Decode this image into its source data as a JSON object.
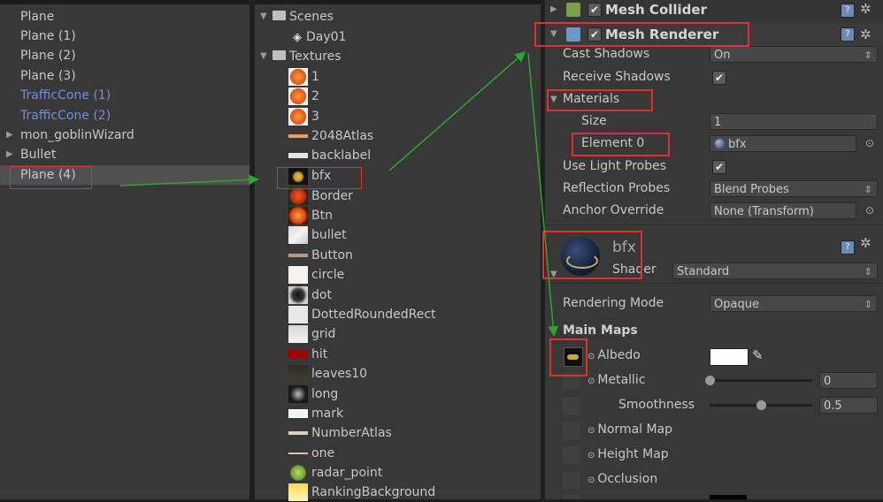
{
  "hierarchy": {
    "items": [
      {
        "label": "Plane"
      },
      {
        "label": "Plane (1)"
      },
      {
        "label": "Plane (2)"
      },
      {
        "label": "Plane (3)"
      },
      {
        "label": "TrafficCone (1)"
      },
      {
        "label": "TrafficCone (2)"
      },
      {
        "label": "mon_goblinWizard"
      },
      {
        "label": "Bullet"
      },
      {
        "label": "Plane (4)"
      }
    ]
  },
  "project": {
    "scenes_label": "Scenes",
    "scene_item": "Day01",
    "textures_label": "Textures",
    "textures": [
      {
        "label": "1"
      },
      {
        "label": "2"
      },
      {
        "label": "3"
      },
      {
        "label": "2048Atlas"
      },
      {
        "label": "backlabel"
      },
      {
        "label": "bfx"
      },
      {
        "label": "Border"
      },
      {
        "label": "Btn"
      },
      {
        "label": "bullet"
      },
      {
        "label": "Button"
      },
      {
        "label": "circle"
      },
      {
        "label": "dot"
      },
      {
        "label": "DottedRoundedRect"
      },
      {
        "label": "grid"
      },
      {
        "label": "hit"
      },
      {
        "label": "leaves10"
      },
      {
        "label": "long"
      },
      {
        "label": "mark"
      },
      {
        "label": "NumberAtlas"
      },
      {
        "label": "one"
      },
      {
        "label": "radar_point"
      },
      {
        "label": "RankingBackground"
      }
    ]
  },
  "inspector": {
    "mesh_collider_title": "Mesh Collider",
    "mesh_renderer_title": "Mesh Renderer",
    "cast_shadows_label": "Cast Shadows",
    "cast_shadows_value": "On",
    "receive_shadows_label": "Receive Shadows",
    "materials_label": "Materials",
    "size_label": "Size",
    "size_value": "1",
    "element0_label": "Element 0",
    "element0_value": "bfx",
    "light_probes_label": "Use Light Probes",
    "reflection_probes_label": "Reflection Probes",
    "reflection_probes_value": "Blend Probes",
    "anchor_override_label": "Anchor Override",
    "anchor_override_value": "None (Transform)",
    "material_name": "bfx",
    "shader_label": "Shader",
    "shader_value": "Standard",
    "rendering_mode_label": "Rendering Mode",
    "rendering_mode_value": "Opaque",
    "main_maps_label": "Main Maps",
    "albedo_label": "Albedo",
    "metallic_label": "Metallic",
    "metallic_value": "0",
    "metallic_level": 0.0,
    "smoothness_label": "Smoothness",
    "smoothness_value": "0.5",
    "smoothness_level": 0.5,
    "normal_map_label": "Normal Map",
    "height_map_label": "Height Map",
    "occlusion_label": "Occlusion"
  },
  "colors": {
    "annotation_red": "#e03030",
    "annotation_green": "#2fa52f",
    "link_blue": "#6f8fe0"
  }
}
